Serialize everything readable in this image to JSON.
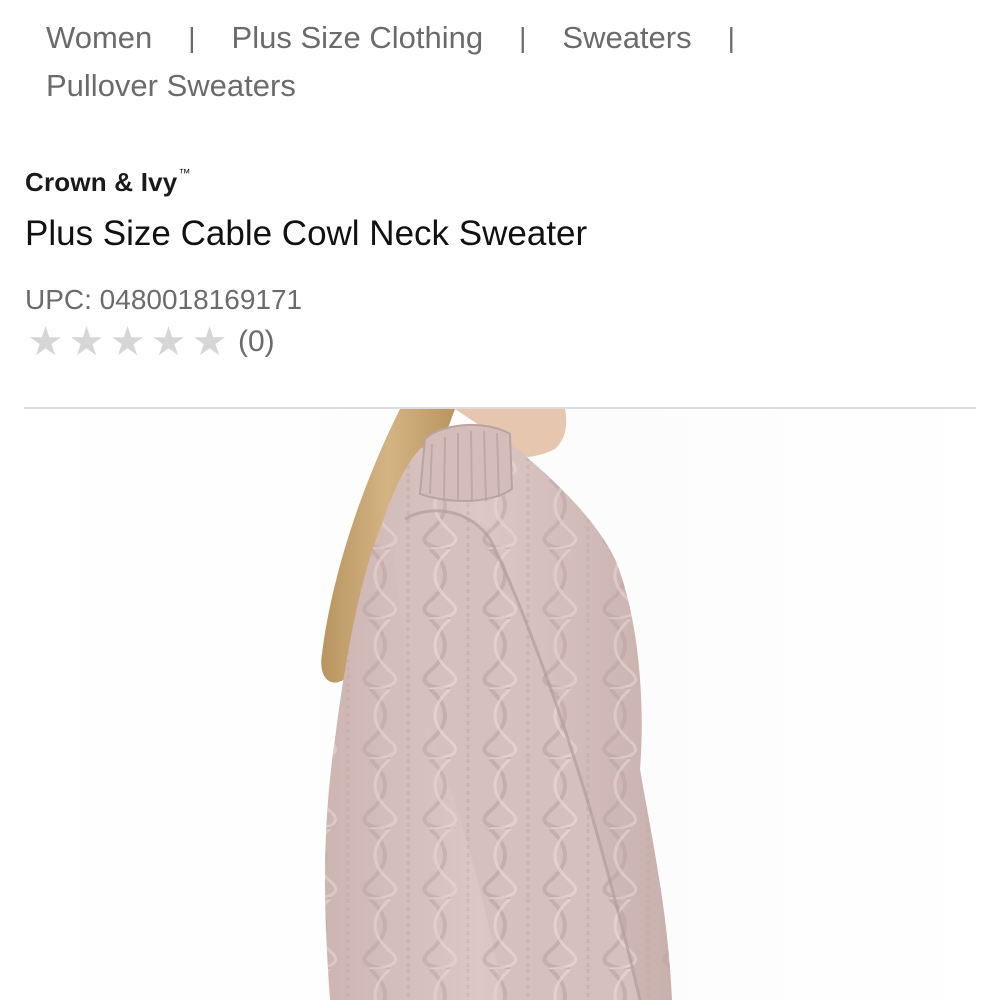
{
  "breadcrumb": {
    "items": [
      "Women",
      "Plus Size Clothing",
      "Sweaters",
      "Pullover Sweaters"
    ],
    "separator": "|"
  },
  "product": {
    "brand": "Crown & Ivy",
    "brand_mark": "™",
    "title": "Plus Size Cable Cowl Neck Sweater",
    "upc": "UPC: 0480018169171",
    "rating": {
      "value": 0,
      "max": 5,
      "count_label": "(0)"
    }
  },
  "image": {
    "subject": "woman-wearing-pink-cable-knit-sweater",
    "colors": {
      "sweater": "#d9c3c0",
      "sweater_shadow": "#bea7a4",
      "hair": "#c9a774",
      "skin": "#e8c9b2"
    }
  }
}
